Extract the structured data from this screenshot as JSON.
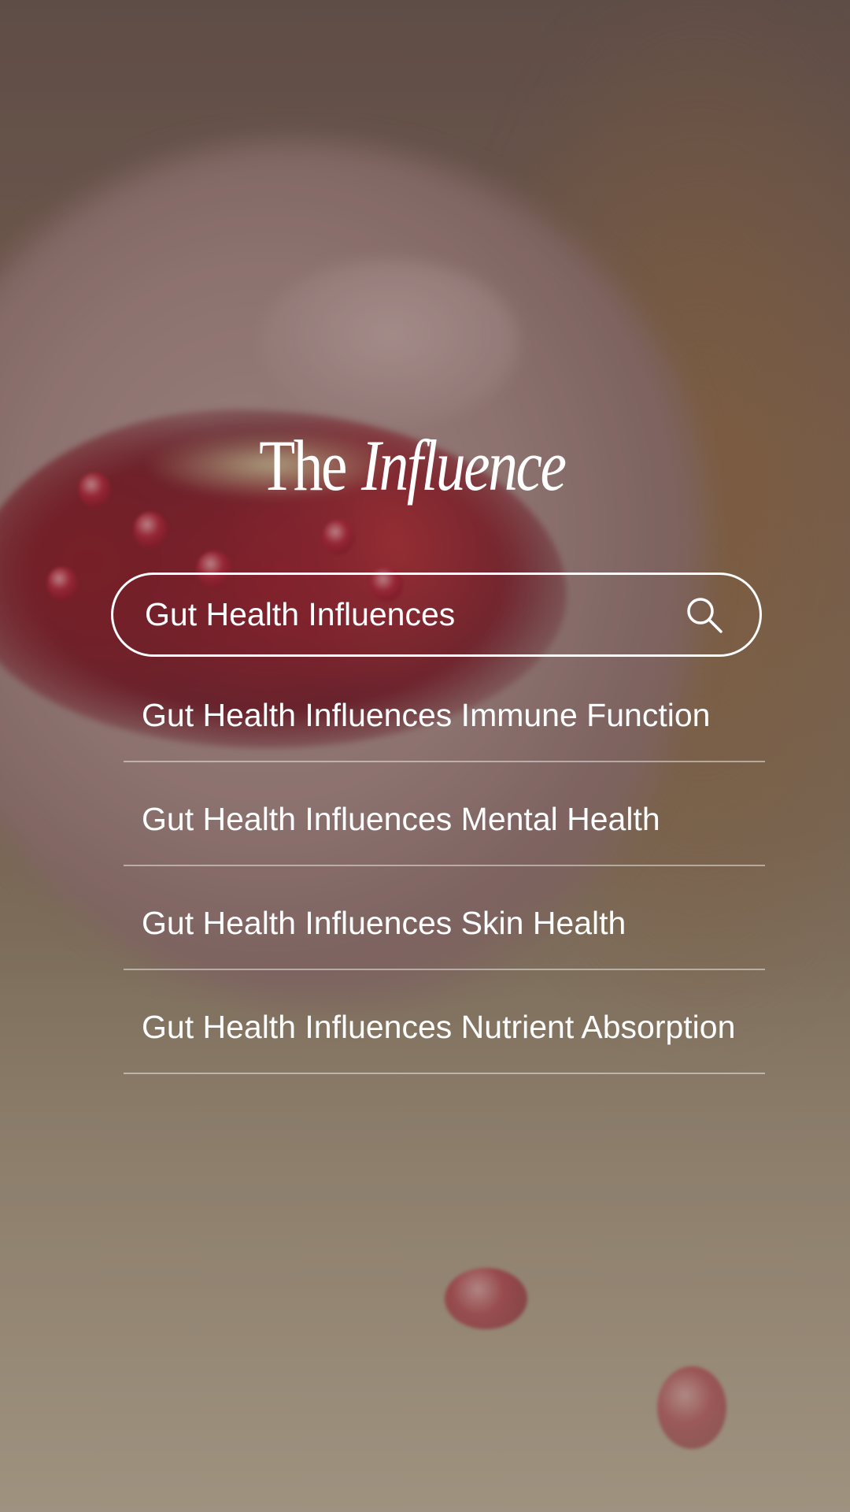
{
  "logo": {
    "part_a": "The",
    "part_b": "Influence"
  },
  "search": {
    "value": "Gut Health Influences",
    "icon": "search-icon"
  },
  "suggestions": [
    {
      "label": "Gut Health Influences Immune Function"
    },
    {
      "label": "Gut Health Influences Mental Health"
    },
    {
      "label": "Gut Health Influences Skin Health"
    },
    {
      "label": "Gut Health Influences Nutrient Absorption"
    }
  ],
  "background": {
    "image": "background-photo",
    "text_color": "#ffffff"
  }
}
